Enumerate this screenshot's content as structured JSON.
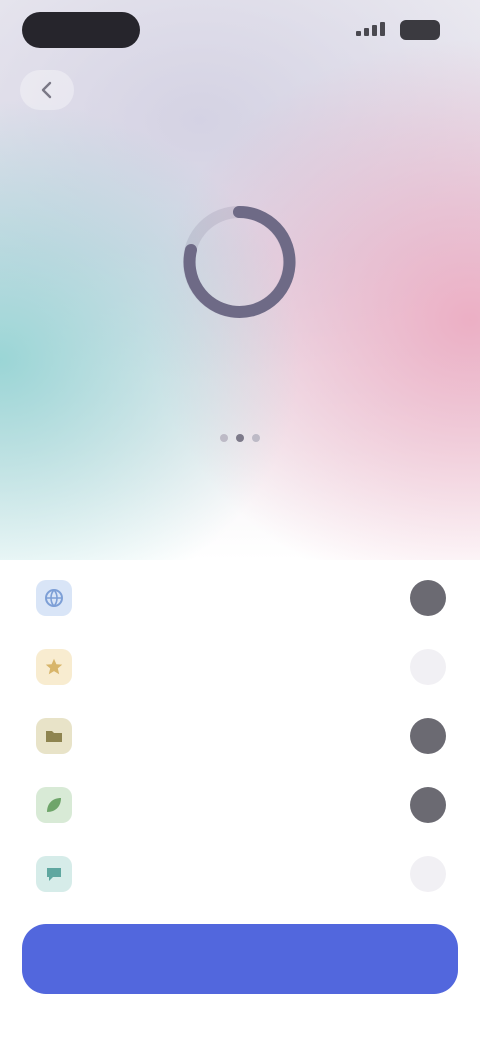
{
  "colors": {
    "accent": "#5267dd",
    "toggle_on": "#6b6a72",
    "toggle_off": "#f1f0f4",
    "headline": "#2a2933"
  },
  "status_bar": {
    "icons": [
      "signal-icon",
      "battery-icon"
    ]
  },
  "nav": {
    "back_icon": "chevron-left-icon",
    "skip_label": ""
  },
  "loader": {
    "icon": "spinner-icon"
  },
  "pager": {
    "count": 3,
    "active": 1
  },
  "headline": {
    "line1": "",
    "line2": ""
  },
  "list": {
    "items": [
      {
        "label": "",
        "icon": "globe-icon",
        "icon_bg": "#d9e5f7",
        "icon_fg": "#7d9fd6",
        "selected": true
      },
      {
        "label": "",
        "icon": "star-icon",
        "icon_bg": "#f8ecd0",
        "icon_fg": "#d8b56a",
        "selected": false
      },
      {
        "label": "",
        "icon": "folder-icon",
        "icon_bg": "#e8e3c8",
        "icon_fg": "#8e8450",
        "selected": true
      },
      {
        "label": "",
        "icon": "leaf-icon",
        "icon_bg": "#d8ead6",
        "icon_fg": "#6fa56a",
        "selected": true
      },
      {
        "label": "",
        "icon": "chat-icon",
        "icon_bg": "#d6ece9",
        "icon_fg": "#5fa7a0",
        "selected": false
      }
    ]
  },
  "cta": {
    "label": ""
  }
}
